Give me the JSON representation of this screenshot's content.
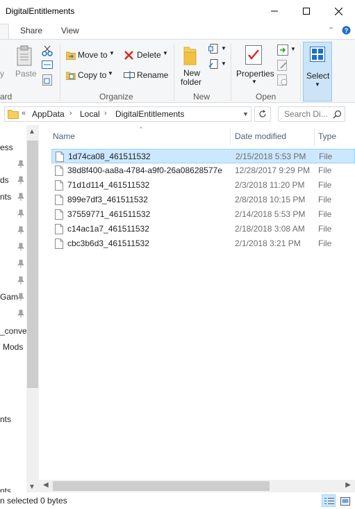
{
  "window": {
    "title": "DigitalEntitlements"
  },
  "ribbon_tabs": [
    {
      "label": "Share"
    },
    {
      "label": "View"
    }
  ],
  "ribbon": {
    "clipboard": {
      "pin_cut_label": "y",
      "paste_label": "Paste",
      "group_label": "ard"
    },
    "organize": {
      "move_to": "Move to",
      "copy_to": "Copy to",
      "delete": "Delete",
      "rename": "Rename",
      "group_label": "Organize"
    },
    "new": {
      "new_folder_line1": "New",
      "new_folder_line2": "folder",
      "group_label": "New"
    },
    "open": {
      "properties": "Properties",
      "group_label": "Open"
    },
    "select": {
      "label": "Select"
    }
  },
  "address": {
    "overflow": "«",
    "crumbs": [
      "AppData",
      "Local",
      "DigitalEntitlements"
    ],
    "search_placeholder": "Search Di..."
  },
  "nav_items": [
    "ess",
    "ds",
    "nts",
    "Gam",
    "_conve",
    "Mods",
    "nts",
    "nts"
  ],
  "columns": {
    "name": "Name",
    "date_modified": "Date modified",
    "type": "Type"
  },
  "files": [
    {
      "name": "1d74ca08_461511532",
      "date": "2/15/2018 5:53 PM",
      "type": "File",
      "selected": true
    },
    {
      "name": "38d8f400-aa8a-4784-a9f0-26a08628577e",
      "date": "12/28/2017 9:29 PM",
      "type": "File"
    },
    {
      "name": "71d1d114_461511532",
      "date": "2/3/2018 11:20 PM",
      "type": "File"
    },
    {
      "name": "899e7df3_461511532",
      "date": "2/8/2018 10:15 PM",
      "type": "File"
    },
    {
      "name": "37559771_461511532",
      "date": "2/14/2018 5:53 PM",
      "type": "File"
    },
    {
      "name": "c14ac1a7_461511532",
      "date": "2/18/2018 3:08 AM",
      "type": "File"
    },
    {
      "name": "cbc3b6d3_461511532",
      "date": "2/1/2018 3:21 PM",
      "type": "File"
    }
  ],
  "status": {
    "selected": "n selected",
    "size": "0 bytes"
  },
  "colors": {
    "selection": "#cce8ff",
    "selection_border": "#99d1ff",
    "accent": "#0078d7"
  }
}
